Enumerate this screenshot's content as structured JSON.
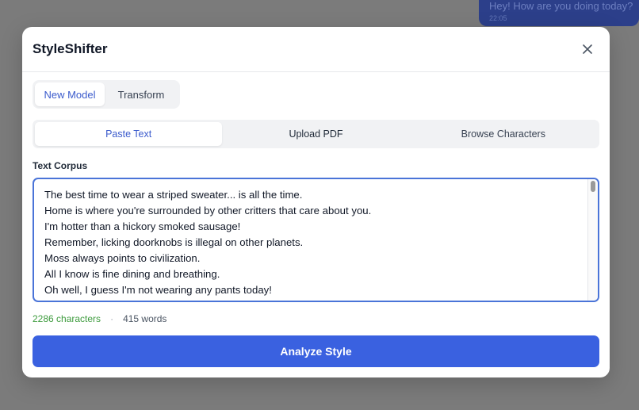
{
  "background": {
    "chat_bubble": {
      "message": "Hey! How are you doing today?",
      "time": "22:05"
    }
  },
  "modal": {
    "title": "StyleShifter",
    "close_icon": "close-icon"
  },
  "mode_tabs": [
    {
      "label": "New Model",
      "active": true
    },
    {
      "label": "Transform",
      "active": false
    }
  ],
  "source_tabs": [
    {
      "label": "Paste Text",
      "active": true
    },
    {
      "label": "Upload PDF",
      "active": false
    },
    {
      "label": "Browse Characters",
      "active": false
    }
  ],
  "corpus": {
    "label": "Text Corpus",
    "value": "The best time to wear a striped sweater... is all the time.\nHome is where you're surrounded by other critters that care about you.\nI'm hotter than a hickory smoked sausage!\nRemember, licking doorknobs is illegal on other planets.\nMoss always points to civilization.\nAll I know is fine dining and breathing.\nOh well, I guess I'm not wearing any pants today!"
  },
  "stats": {
    "characters": "2286 characters",
    "separator": "·",
    "words": "415 words"
  },
  "analyze_button": {
    "label": "Analyze Style"
  },
  "colors": {
    "accent": "#3a61e0",
    "active_tab_text": "#3b5bcc",
    "success_text": "#3d9b3d",
    "overlay": "#7b7b7b"
  }
}
